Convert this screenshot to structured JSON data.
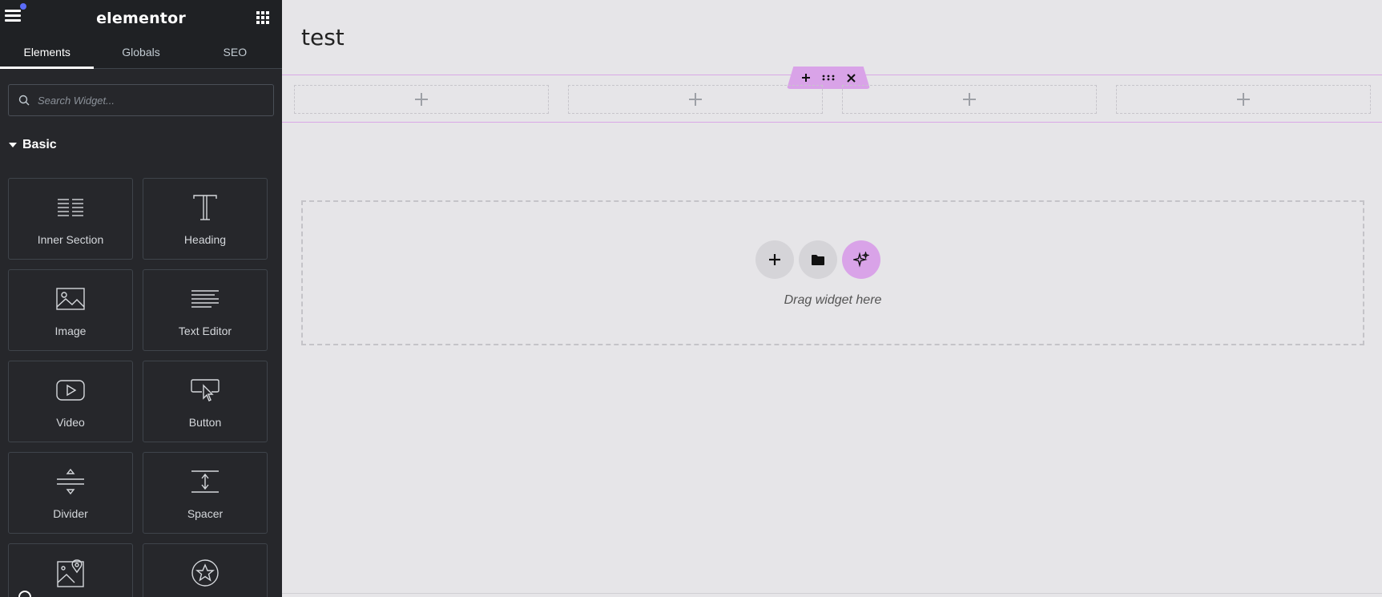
{
  "app": {
    "logo_text": "elementor",
    "brand_color": "#d9a3e8",
    "sidebar_bg": "#26272b",
    "icons": [
      "hamburger-menu-icon",
      "apps-grid-icon",
      "search-icon",
      "collapse-chevron-icon"
    ]
  },
  "sidebar": {
    "tabs": [
      {
        "label": "Elements",
        "active": true
      },
      {
        "label": "Globals",
        "active": false
      },
      {
        "label": "SEO",
        "active": false
      }
    ],
    "search": {
      "placeholder": "Search Widget..."
    },
    "category": {
      "label": "Basic",
      "expanded": true
    },
    "widgets": [
      {
        "label": "Inner Section",
        "icon": "inner-section-icon"
      },
      {
        "label": "Heading",
        "icon": "heading-icon"
      },
      {
        "label": "Image",
        "icon": "image-icon"
      },
      {
        "label": "Text Editor",
        "icon": "text-editor-icon"
      },
      {
        "label": "Video",
        "icon": "video-icon"
      },
      {
        "label": "Button",
        "icon": "button-icon"
      },
      {
        "label": "Divider",
        "icon": "divider-icon"
      },
      {
        "label": "Spacer",
        "icon": "spacer-icon"
      },
      {
        "label": "",
        "icon": "google-maps-icon"
      },
      {
        "label": "",
        "icon": "star-icon"
      }
    ]
  },
  "canvas": {
    "page_title": "test",
    "section": {
      "columns": 4,
      "handle_buttons": [
        "add-section-icon",
        "drag-handle-icon",
        "close-icon"
      ]
    },
    "drop_zone": {
      "text": "Drag widget here",
      "buttons": [
        "add-icon",
        "folder-icon",
        "ai-sparkle-icon"
      ]
    }
  }
}
